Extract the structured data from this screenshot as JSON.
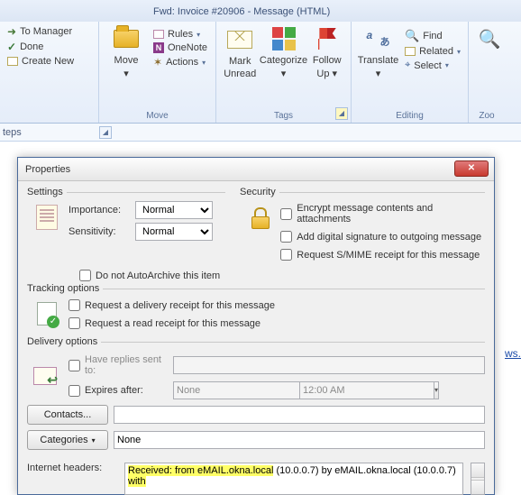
{
  "window": {
    "title": "Fwd: Invoice #20906  -  Message (HTML)"
  },
  "stepsbar": "teps",
  "ribbon": {
    "respond": {
      "to_manager": "To Manager",
      "done": "Done",
      "create_new": "Create New"
    },
    "move": {
      "move": "Move",
      "rules": "Rules",
      "onenote": "OneNote",
      "actions": "Actions",
      "label": "Move"
    },
    "tags": {
      "mark_unread1": "Mark",
      "mark_unread2": "Unread",
      "categorize": "Categorize",
      "follow_up1": "Follow",
      "follow_up2": "Up",
      "label": "Tags"
    },
    "editing": {
      "translate": "Translate",
      "find": "Find",
      "related": "Related",
      "select": "Select",
      "label": "Editing"
    },
    "zoom": {
      "label": "Zoo"
    }
  },
  "link_frag": "ws.",
  "dialog": {
    "title": "Properties",
    "settings": {
      "legend": "Settings",
      "importance": "Importance:",
      "importance_val": "Normal",
      "sensitivity": "Sensitivity:",
      "sensitivity_val": "Normal",
      "autoarchive": "Do not AutoArchive this item"
    },
    "security": {
      "legend": "Security",
      "encrypt": "Encrypt message contents and attachments",
      "sign": "Add digital signature to outgoing message",
      "receipt": "Request S/MIME receipt for this message"
    },
    "tracking": {
      "legend": "Tracking options",
      "delivery": "Request a delivery receipt for this message",
      "read": "Request a read receipt for this message"
    },
    "delivery": {
      "legend": "Delivery options",
      "replies": "Have replies sent to:",
      "expires": "Expires after:",
      "expires_val": "None",
      "expires_time": "12:00 AM",
      "contacts": "Contacts...",
      "categories": "Categories",
      "categories_val": "None"
    },
    "headers": {
      "label": "Internet headers:",
      "hl_prefix": "Received: from eMAIL.okna.local",
      "rest1": " (10.0.0.7) by eMAIL.okna.local (10.0.0.7)",
      "hl_with": "with"
    }
  }
}
